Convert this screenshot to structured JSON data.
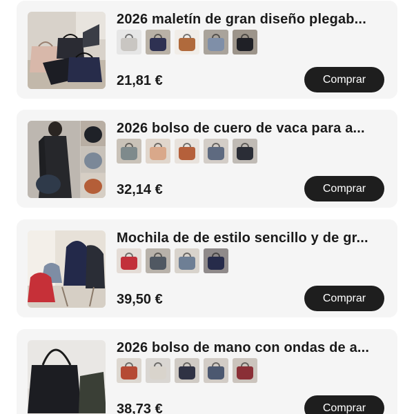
{
  "products": [
    {
      "title": "2026 maletín de gran diseño plegab...",
      "price": "21,81 €",
      "buy_label": "Comprar",
      "variants": [
        {
          "bg": "#e6e6e6",
          "bag": "#c9c6c2"
        },
        {
          "bg": "#b9b1a6",
          "bag": "#2e3152"
        },
        {
          "bg": "#f1ede8",
          "bag": "#b06a3c"
        },
        {
          "bg": "#a9a39b",
          "bag": "#7f8fa8"
        },
        {
          "bg": "#9c948a",
          "bag": "#1f2026"
        }
      ]
    },
    {
      "title": "2026 bolso de cuero de vaca para a...",
      "price": "32,14 €",
      "buy_label": "Comprar",
      "variants": [
        {
          "bg": "#c9c2b8",
          "bag": "#7e8a8c"
        },
        {
          "bg": "#e0d6cc",
          "bag": "#d9a88a"
        },
        {
          "bg": "#e8e2dc",
          "bag": "#b5603b"
        },
        {
          "bg": "#d3cdc7",
          "bag": "#5e6a80"
        },
        {
          "bg": "#c0bbb5",
          "bag": "#2a2d36"
        }
      ]
    },
    {
      "title": "Mochila de de estilo sencillo y de gr...",
      "price": "39,50 €",
      "buy_label": "Comprar",
      "variants": [
        {
          "bg": "#e4dcd6",
          "bag": "#c2303a"
        },
        {
          "bg": "#b8b2aa",
          "bag": "#505862"
        },
        {
          "bg": "#d8d3cc",
          "bag": "#6e7f95"
        },
        {
          "bg": "#8f8a8a",
          "bag": "#262b4a"
        }
      ]
    },
    {
      "title": "2026 bolso de mano con ondas de a...",
      "price": "38,73 €",
      "buy_label": "Comprar",
      "variants": [
        {
          "bg": "#dcd7d0",
          "bag": "#b54a34"
        },
        {
          "bg": "#d9d6d2",
          "bag": "#d9d4cc"
        },
        {
          "bg": "#cfcac4",
          "bag": "#2f3244"
        },
        {
          "bg": "#d2ccc6",
          "bag": "#4c5870"
        },
        {
          "bg": "#cbc4bd",
          "bag": "#8a2f36"
        }
      ]
    }
  ]
}
